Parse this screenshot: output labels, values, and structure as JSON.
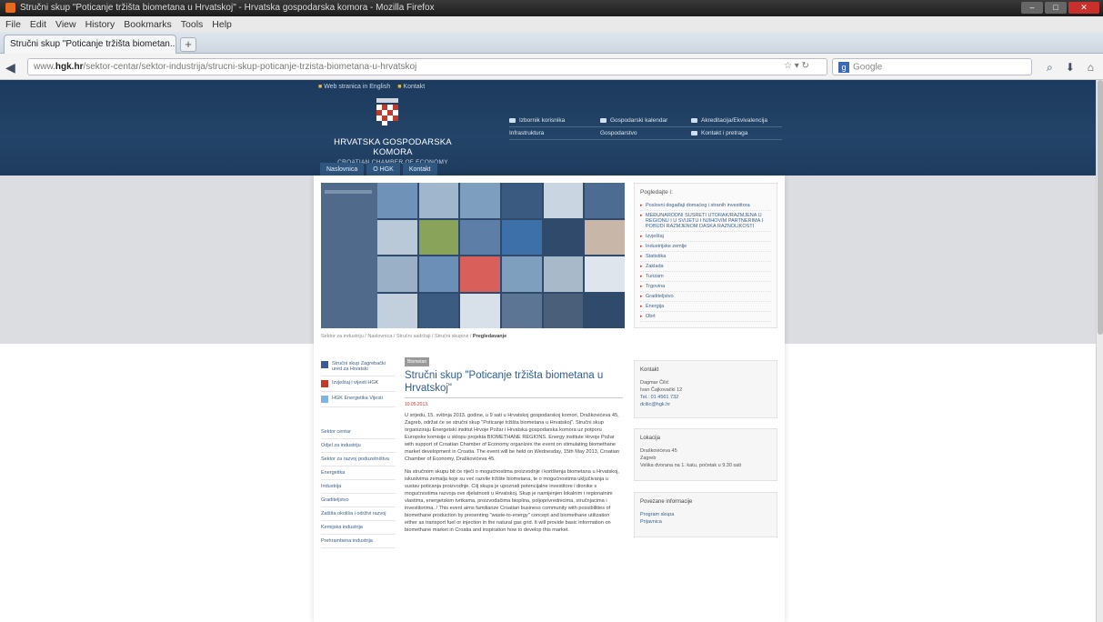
{
  "browser": {
    "window_title": "Stručni skup \"Poticanje tržišta biometana u Hrvatskoj\" - Hrvatska gospodarska komora - Mozilla Firefox",
    "menu": [
      "File",
      "Edit",
      "View",
      "History",
      "Bookmarks",
      "Tools",
      "Help"
    ],
    "tab_title": "Stručni skup \"Poticanje tržišta biometan...",
    "new_tab": "+",
    "url_prefix": "www.",
    "url_domain": "hgk.hr",
    "url_rest": "/sektor-centar/sektor-industrija/strucni-skup-poticanje-trzista-biometana-u-hrvatskoj",
    "search_engine": "Google",
    "search_placeholder": "Google",
    "accent": "#e76a1f"
  },
  "site": {
    "top_links": [
      "Web stranica in English",
      "Kontakt"
    ],
    "brand_name": "HRVATSKA GOSPODARSKA KOMORA",
    "brand_sub": "CROATIAN CHAMBER OF ECONOMY",
    "topnav": [
      [
        "Izbornik korisnika",
        "Gospodarski kalendar",
        "Akreditacija/Ekvivalencija"
      ],
      [
        "Infrastruktura",
        "Gospodarstvo",
        "Kontakt i pretraga"
      ]
    ],
    "mainnav": [
      "Naslovnica",
      "O HGK",
      "Kontakt"
    ],
    "right_panel_title": "Pogledajte i:",
    "right_panel_items": [
      "Poslovni događaji domaćeg i stranih investitora",
      "MEĐUNARODNI SUSRETI UTORAK/RAZMJENA U REGIONU I U SVIJETU I NJIHOVIM PARTNERIMA I POBUDI RAZMJENOM DASKA RAZNOLIKOSTI",
      "Izvještaj",
      "Industrijske zemlje",
      "Statistika",
      "Zaklada",
      "Turizam",
      "Trgovina",
      "Graditeljstvo",
      "Energija",
      "Obrt"
    ],
    "breadcrumb": "Sektor za industriju / Naslovnica / Stručni sadržaji / Stručni skupovi /",
    "breadcrumb_current": "Pregledavanje",
    "left_blocks": [
      {
        "label": "Stručni skup Zagrebački ured za Hrvatski",
        "color": "#3b5998"
      },
      {
        "label": "Izvještaj i vijesti HGK",
        "color": "#c0392b"
      },
      {
        "label": "HGK Energetika Vijesti",
        "color": "#7fb3e0"
      }
    ],
    "left_menu": [
      "Sektor centar",
      "Odjel za industriju",
      "Sektor za razvoj poduzetništva",
      "Energetika",
      "Industrija",
      "Graditeljstvo",
      "Zaštita okoliša i održivi razvoj",
      "Kemijska industrija",
      "Prehrambena industrija"
    ],
    "article_tag": "Biometan",
    "article_title": "Stručni skup \"Poticanje tržišta biometana u Hrvatskoj\"",
    "article_date": "10.05.2013.",
    "article_p1": "U srijedu, 15. svibnja 2013. godine, u 9 sati u Hrvatskoj gospodarskoj komori, Draškovićeva 45, Zagreb, održat će se stručni skup \"Poticanje tržišta biometana u Hrvatskoj\". Stručni skup organiziraju Energetski institut Hrvoje Požar i Hrvatska gospodarska komora uz potporu Europske komisije u sklopu projekta BIOMETHANE REGIONS. Energy institute Hrvoje Požar with support of Croatian Chamber of Economy organizes the event on stimulating biomethane market development in Croatia. The event will be held on Wednesday, 15th May 2013, Croatian Chamber of Economy, Draškovićeva 45.",
    "article_p2": "Na stručnom skupu bit će riječi o mogućnostima proizvodnje i korištenja biometana u Hrvatskoj, iskustvima zemalja koje su već razvile tržište biometana, te o mogućnostima uključivanja u sustav poticanja proizvodnje. Cilj skupa je upoznati potencijalne investitore i dionike s mogućnostima razvoja ove djelatnosti u Hrvatskoj. Skup je namijenjen lokalnim i regionalnim vlastima, energetskim tvrtkama, proizvođačima bioplina, poljoprivrednicima, stručnjacima i investitorima. / This event aims familiarize Croatian business community with possibilities of biomethane production by presenting \"waste-to-energy\" concept and biomethane utilization either as transport fuel or injection in the natural gas grid. It will provide basic information on biomethane market in Croatia and inspiration how to develop this market.",
    "right_box1_title": "Kontakt",
    "right_box1_lines": [
      "Dagmar Čilić",
      "Ivan Čajkovački 12",
      "Tel.: 01 4561 732",
      "dcilic@hgk.hr"
    ],
    "right_box2_title": "Lokacija",
    "right_box2_lines": [
      "Draškovićeva 45",
      "Zagreb",
      "Velika dvorana na 1. katu, početak u 9.30 sati"
    ],
    "right_box3_title": "Povezane informacije",
    "right_box3_links": [
      "Program skupa",
      "Prijavnica"
    ]
  }
}
